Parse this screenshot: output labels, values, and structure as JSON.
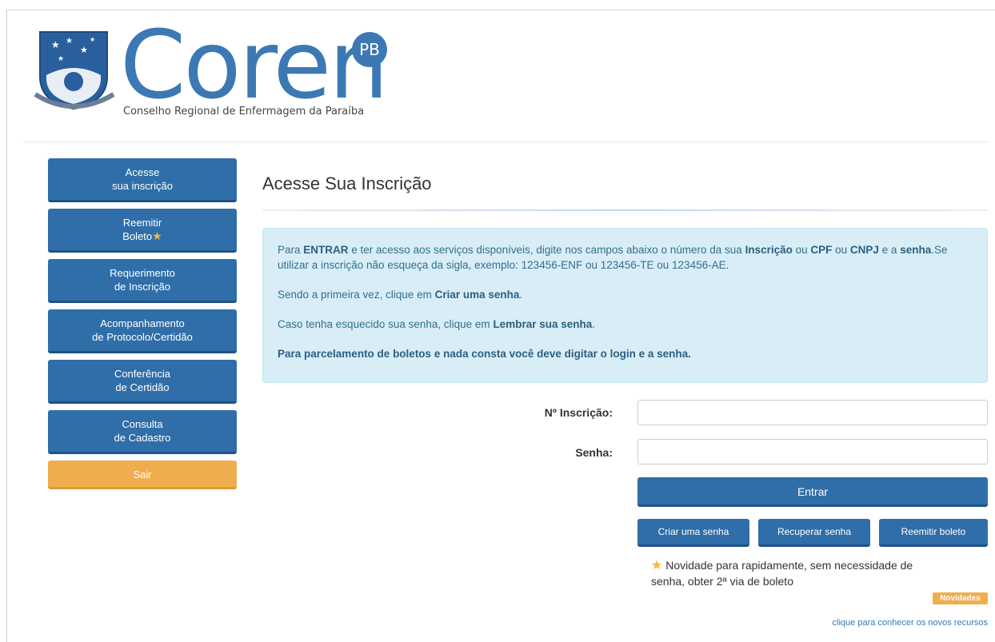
{
  "brand": {
    "logo_word": "Coren",
    "logo_badge": "PB",
    "logo_subtitle": "Conselho Regional de Enfermagem da Paraíba",
    "primary_color": "#2f6ea8",
    "accent_color": "#f0ad4e"
  },
  "sidebar": {
    "items": [
      {
        "line1": "Acesse",
        "line2": "sua inscrição"
      },
      {
        "line1": "Reemitir",
        "line2": "Boleto",
        "icon": "star-icon"
      },
      {
        "line1": "Requerimento",
        "line2": "de Inscrição"
      },
      {
        "line1": "Acompanhamento",
        "line2": "de Protocolo/Certidão"
      },
      {
        "line1": "Conferência",
        "line2": "de Certidão"
      },
      {
        "line1": "Consulta",
        "line2": "de Cadastro"
      }
    ],
    "logout": "Sair"
  },
  "main": {
    "title": "Acesse Sua Inscrição",
    "info": {
      "p1_a": "Para ",
      "p1_b": "ENTRAR",
      "p1_c": " e ter acesso aos serviços disponíveis, digite nos campos abaixo o número da sua ",
      "p1_d": "Inscrição",
      "p1_e": " ou ",
      "p1_f": "CPF",
      "p1_g": " ou ",
      "p1_h": "CNPJ",
      "p1_i": " e a ",
      "p1_j": "senha",
      "p1_k": ".Se utilizar a inscrição não esqueça da sigla, exemplo: 123456-ENF ou 123456-TE ou 123456-AE.",
      "p2_a": "Sendo a primeira vez, clique em ",
      "p2_b": "Criar uma senha",
      "p2_c": ".",
      "p3_a": "Caso tenha esquecido sua senha, clique em ",
      "p3_b": "Lembrar sua senha",
      "p3_c": ".",
      "p4": "Para parcelamento de boletos e nada consta você deve digitar o login e a senha."
    },
    "form": {
      "inscricao_label": "Nº Inscrição:",
      "inscricao_value": "",
      "senha_label": "Senha:",
      "senha_value": "",
      "submit": "Entrar",
      "create_password": "Criar uma senha",
      "recover_password": "Recuperar senha",
      "reissue_boleto": "Reemitir boleto"
    },
    "news": {
      "text": "Novidade para rapidamente, sem necessidade de senha, obter 2ª via de boleto",
      "badge": "Novidades",
      "link": "clique para conhecer os novos recursos"
    }
  }
}
